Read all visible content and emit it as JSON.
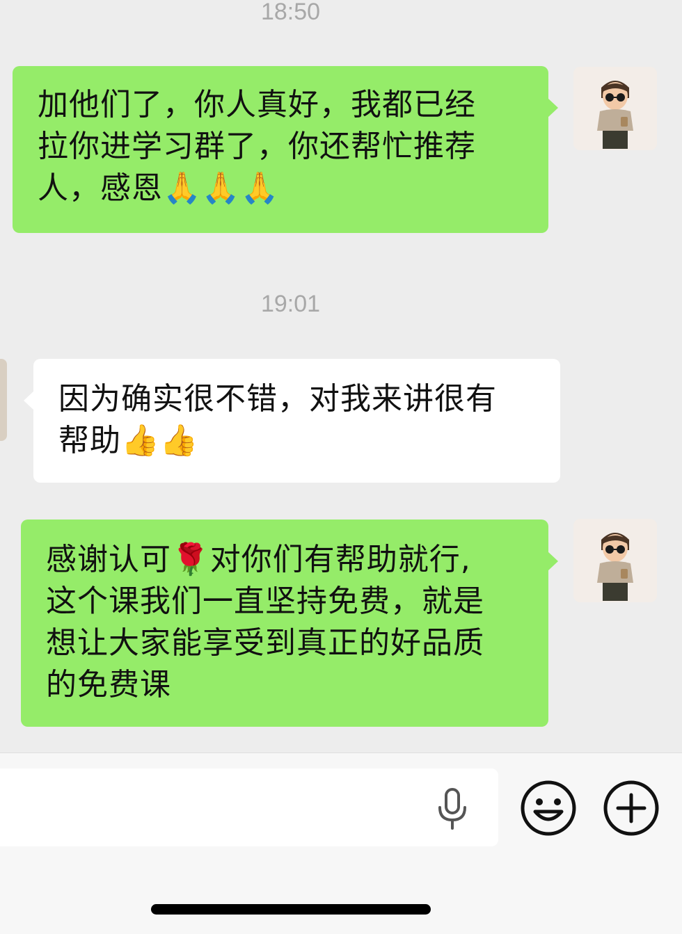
{
  "chat": {
    "timestamp_1": "18:50",
    "timestamp_2": "19:01",
    "msg1": {
      "line1": "加他们了，你人真好，我都已经",
      "line2": "拉你进学习群了，你还帮忙推荐",
      "line3_text": "人，感恩",
      "line3_emoji": "🙏🙏🙏"
    },
    "msg2": {
      "line1": "因为确实很不错，对我来讲很有",
      "line2_text": "帮助",
      "line2_emoji": "👍👍"
    },
    "msg3": {
      "line1_a": "感谢认可",
      "line1_rose": "🌹",
      "line1_b": "对你们有帮助就行,",
      "line2": "这个课我们一直坚持免费，就是",
      "line3": "想让大家能享受到真正的好品质",
      "line4": "的免费课"
    }
  },
  "colors": {
    "sent_bubble": "#95ec69",
    "received_bubble": "#ffffff",
    "background": "#ededed"
  },
  "icons": {
    "input_mic": "microphone-icon",
    "emoji_button": "smiley-face-icon",
    "more_button": "plus-circle-icon"
  }
}
